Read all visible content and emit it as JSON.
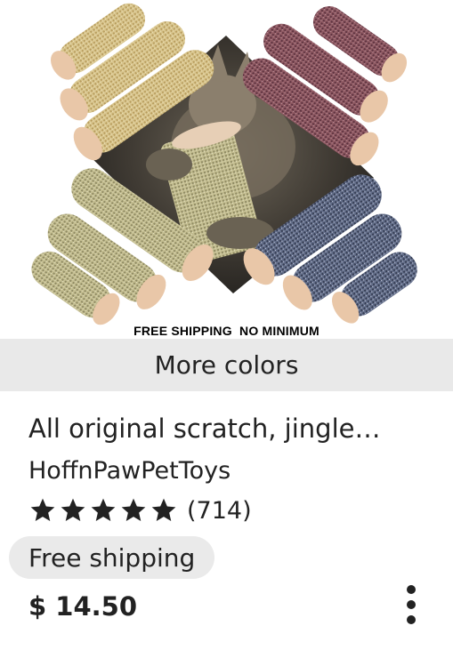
{
  "listing": {
    "image_promo_text": "FREE SHIPPING  NO MINIMUM",
    "more_colors_label": "More colors",
    "title": "All original scratch, jingle…",
    "shop_name": "HoffnPawPetToys",
    "rating": 5,
    "review_count": "(714)",
    "shipping_badge": "Free shipping",
    "price": "$ 14.50"
  },
  "icons": {
    "favorite": "heart-outline-icon",
    "star": "star-icon",
    "more": "more-vertical-icon"
  },
  "colors": {
    "tan": "#d6c08a",
    "maroon": "#8a5560",
    "beige": "#c6c093",
    "denim": "#5f6a86",
    "end_cap": "#e9c7a8",
    "more_colors_bg": "#e9e9e9",
    "badge_bg": "#eaeaea"
  }
}
